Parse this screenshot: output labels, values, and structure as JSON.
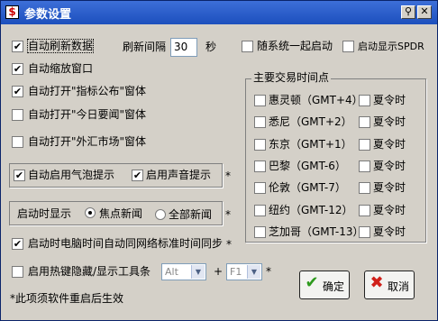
{
  "window": {
    "title": "参数设置",
    "app_icon_glyph": "$",
    "titlebar_buttons": [
      {
        "name": "pin-icon",
        "glyph": "⚲"
      },
      {
        "name": "close-icon",
        "glyph": "✕"
      }
    ]
  },
  "options": {
    "auto_refresh": {
      "label": "自动刷新数据",
      "checked": true
    },
    "refresh_interval_label": "刷新间隔",
    "refresh_interval_value": "30",
    "refresh_interval_unit": "秒",
    "auto_minimize": {
      "label": "自动缩放窗口",
      "checked": true
    },
    "open_indicator": {
      "label": "自动打开\"指标公布\"窗体",
      "checked": true
    },
    "open_news": {
      "label": "自动打开\"今日要闻\"窗体",
      "checked": false
    },
    "open_forex": {
      "label": "自动打开\"外汇市场\"窗体",
      "checked": false
    },
    "start_with_system": {
      "label": "随系统一起启动",
      "checked": false
    },
    "show_spdr": {
      "label": "启动显示SPDR",
      "checked": false
    }
  },
  "bubble_group": {
    "balloon": {
      "label": "自动启用气泡提示",
      "checked": true
    },
    "sound": {
      "label": "启用声音提示",
      "checked": true
    },
    "asterisk": "*"
  },
  "startup_group": {
    "label": "启动时显示",
    "options": [
      {
        "label": "焦点新闻",
        "selected": true
      },
      {
        "label": "全部新闻",
        "selected": false
      }
    ],
    "asterisk": "*"
  },
  "time_sync": {
    "label": "启动时电脑时间自动同网络标准时间同步",
    "checked": true,
    "asterisk": "*"
  },
  "hotkey": {
    "label": "启用热键隐藏/显示工具条",
    "checked": false,
    "modifier": "Alt",
    "plus": "+",
    "key": "F1",
    "asterisk": "*"
  },
  "note": "*此项须软件重启后生效",
  "trading_hours": {
    "title": "主要交易时间点",
    "dst_label": "夏令时",
    "markets": [
      {
        "name": "惠灵顿（GMT+4）",
        "checked": false,
        "dst": false
      },
      {
        "name": "悉尼（GMT+2）",
        "checked": false,
        "dst": false
      },
      {
        "name": "东京（GMT+1）",
        "checked": false,
        "dst": false
      },
      {
        "name": "巴黎（GMT-6）",
        "checked": false,
        "dst": false
      },
      {
        "name": "伦敦（GMT-7）",
        "checked": false,
        "dst": false
      },
      {
        "name": "纽约（GMT-12）",
        "checked": false,
        "dst": false
      },
      {
        "name": "芝加哥（GMT-13）",
        "checked": false,
        "dst": false
      }
    ]
  },
  "buttons": {
    "ok": {
      "label": "确定",
      "icon": "check-icon",
      "color": "#2e9a1e"
    },
    "cancel": {
      "label": "取消",
      "icon": "cross-icon",
      "color": "#d0201a"
    }
  },
  "colors": {
    "titlebar": "#2458c9",
    "dialog_bg": "#d4d0c8"
  }
}
